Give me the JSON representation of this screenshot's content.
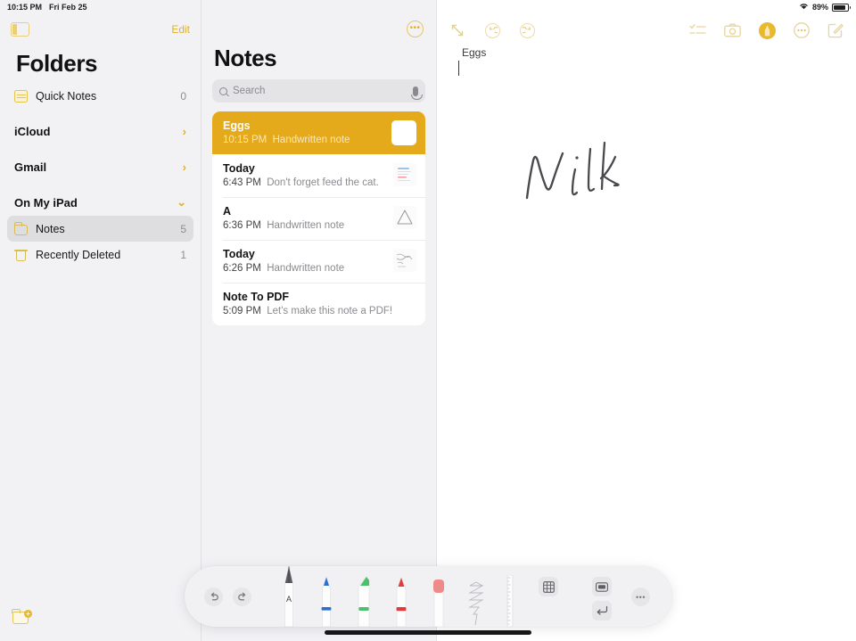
{
  "status_bar": {
    "time": "10:15 PM",
    "date": "Fri Feb 25",
    "wifi_icon": "wifi-icon",
    "battery_percent": "89%",
    "battery_icon": "battery-icon"
  },
  "sidebar": {
    "toggle_icon": "sidebar-toggle-icon",
    "edit_label": "Edit",
    "title": "Folders",
    "new_folder_icon": "new-folder-icon",
    "rows": [
      {
        "label": "Quick Notes",
        "count": "0",
        "icon": "quick-note-icon",
        "selected": false
      },
      {
        "label": "Notes",
        "count": "5",
        "icon": "folder-icon",
        "selected": true
      },
      {
        "label": "Recently Deleted",
        "count": "1",
        "icon": "trash-icon",
        "selected": false
      }
    ],
    "sections": [
      {
        "label": "iCloud",
        "chevron": "›"
      },
      {
        "label": "Gmail",
        "chevron": "›"
      },
      {
        "label": "On My iPad",
        "chevron": "⌄"
      }
    ]
  },
  "notelist": {
    "more_icon": "more-ellipsis-icon",
    "more_label": "•••",
    "title": "Notes",
    "search": {
      "placeholder": "Search",
      "value": "",
      "search_icon": "search-icon",
      "mic_icon": "microphone-icon"
    },
    "notes": [
      {
        "title": "Eggs",
        "time": "10:15 PM",
        "preview": "Handwritten note",
        "thumb": "blank",
        "selected": true
      },
      {
        "title": "Today",
        "time": "6:43 PM",
        "preview": "Don't forget feed the cat.",
        "thumb": "lines",
        "selected": false
      },
      {
        "title": "A",
        "time": "6:36 PM",
        "preview": "Handwritten note",
        "thumb": "triangle",
        "selected": false
      },
      {
        "title": "Today",
        "time": "6:26 PM",
        "preview": "Handwritten note",
        "thumb": "scribble",
        "selected": false
      },
      {
        "title": "Note To PDF",
        "time": "5:09 PM",
        "preview": "Let's make this note a PDF!",
        "thumb": "none",
        "selected": false
      }
    ]
  },
  "editor": {
    "expand_icon": "expand-arrows-icon",
    "undo_icon": "undo-circle-icon",
    "redo_icon": "redo-circle-icon",
    "checklist_icon": "checklist-icon",
    "camera_icon": "camera-icon",
    "markup_icon": "markup-pen-icon",
    "more_icon": "more-ellipsis-circle-icon",
    "compose_icon": "compose-note-icon",
    "note_title": "Eggs",
    "handwriting_text": "Milk"
  },
  "palette": {
    "undo_icon": "undo-icon",
    "redo_icon": "redo-icon",
    "tools": [
      {
        "name": "scribble-pen-tool",
        "label": "A",
        "color": "#4a4a4e",
        "selected": true
      },
      {
        "name": "blue-pen-tool",
        "label": "",
        "color": "#2b6fd4",
        "selected": false
      },
      {
        "name": "green-highlighter-tool",
        "label": "",
        "color": "#4cc06a",
        "selected": false
      },
      {
        "name": "red-marker-tool",
        "label": "",
        "color": "#e23b3b",
        "selected": false
      },
      {
        "name": "pink-eraser-tool",
        "label": "",
        "color": "#ef8a8a",
        "selected": false
      },
      {
        "name": "lasso-select-tool",
        "label": "",
        "color": "#b9b9be",
        "selected": false
      },
      {
        "name": "ruler-tool",
        "label": "",
        "color": "#cfcfd4",
        "selected": false
      }
    ],
    "table_icon": "table-icon",
    "color_swatch": "#e3e3e6",
    "keyboard_icon": "keyboard-icon",
    "return_icon": "return-key-icon",
    "more_icon": "more-ellipsis-icon",
    "more_label": "•••"
  },
  "theme": {
    "accent": "#e5a91c",
    "sidebar_bg": "#f2f2f5",
    "selected_row_bg": "#dedee1",
    "ink": "#4a4a4e"
  }
}
